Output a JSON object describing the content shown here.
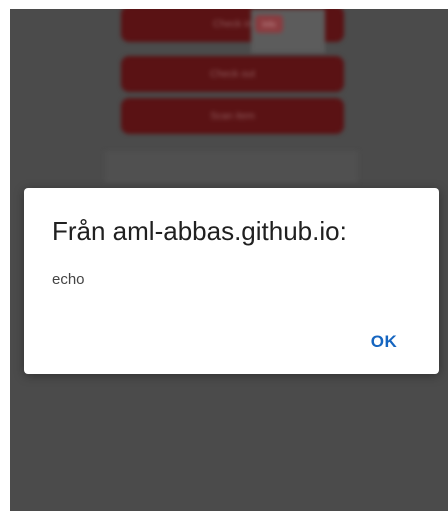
{
  "background_page": {
    "buttons": [
      {
        "label": "Check in"
      },
      {
        "label": "Check out"
      },
      {
        "label": "Scan item"
      }
    ],
    "popup_tag": "Info",
    "field_value": ""
  },
  "dialog": {
    "title": "Från aml-abbas.github.io:",
    "message": "echo",
    "ok_label": "OK"
  },
  "colors": {
    "dim_background": "#4b4b4b",
    "button_dimmed": "#5a1214",
    "dialog_background": "#ffffff",
    "ok_accent": "#1565c0"
  }
}
